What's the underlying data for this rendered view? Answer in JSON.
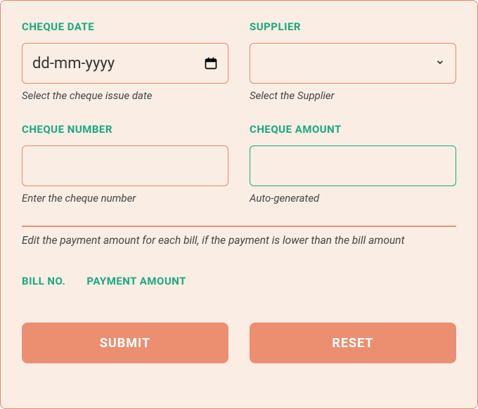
{
  "fields": {
    "cheque_date": {
      "label": "CHEQUE DATE",
      "placeholder": "dd-mm-yyyy",
      "hint": "Select the cheque issue date"
    },
    "supplier": {
      "label": "SUPPLIER",
      "hint": "Select the Supplier"
    },
    "cheque_number": {
      "label": "CHEQUE NUMBER",
      "hint": "Enter the cheque number"
    },
    "cheque_amount": {
      "label": "CHEQUE AMOUNT",
      "hint": "Auto-generated"
    }
  },
  "instruction": "Edit the payment amount for each bill, if the payment is lower than the bill amount",
  "table": {
    "columns": {
      "bill_no": "BILL NO.",
      "payment_amount": "PAYMENT AMOUNT"
    }
  },
  "buttons": {
    "submit": "SUBMIT",
    "reset": "RESET"
  },
  "colors": {
    "accent_green": "#19a87e",
    "accent_orange": "#ec8f70",
    "border_orange": "#e98669",
    "bg": "#faeee4"
  }
}
